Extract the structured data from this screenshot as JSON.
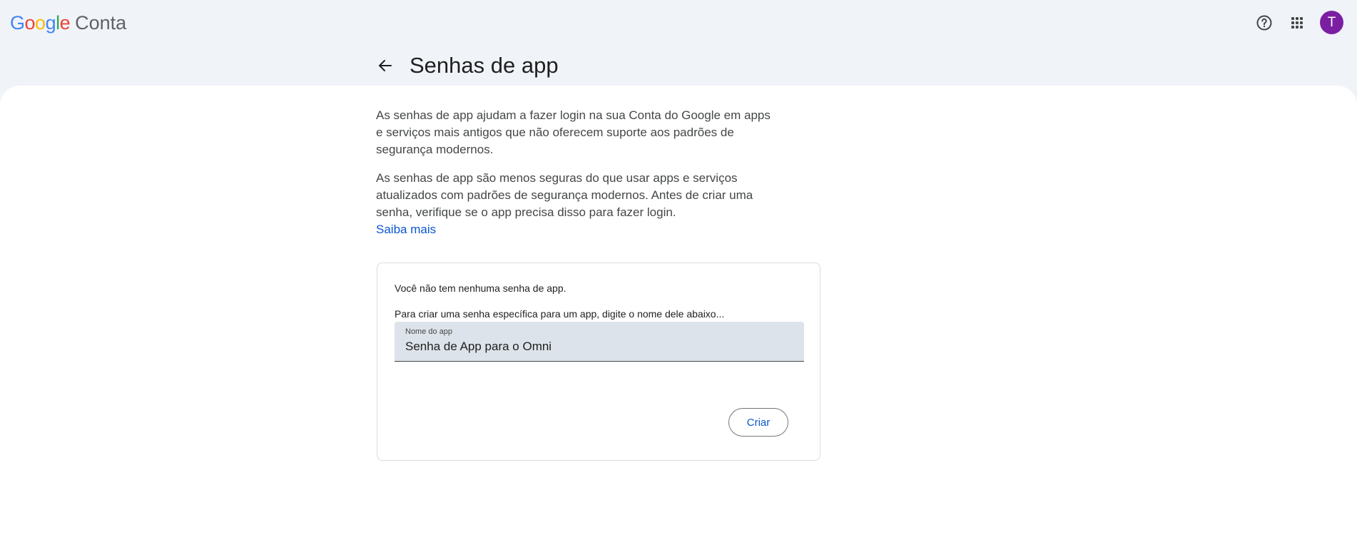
{
  "header": {
    "logo_google": "Google",
    "logo_product": "Conta",
    "avatar_initial": "T",
    "avatar_color": "#7b1fa2"
  },
  "page": {
    "title": "Senhas de app",
    "paragraph1": "As senhas de app ajudam a fazer login na sua Conta do Google em apps e serviços mais antigos que não oferecem suporte aos padrões de segurança modernos.",
    "paragraph2": "As senhas de app são menos seguras do que usar apps e serviços atualizados com padrões de segurança modernos. Antes de criar uma senha, verifique se o app precisa disso para fazer login.",
    "learn_more": "Saiba mais"
  },
  "card": {
    "empty_message": "Você não tem nenhuma senha de app.",
    "instructions": "Para criar uma senha específica para um app, digite o nome dele abaixo...",
    "field_label": "Nome do app",
    "field_value": "Senha de App para o Omni",
    "create_button": "Criar"
  },
  "icons": {
    "help": "help-circle-icon",
    "apps": "apps-grid-icon",
    "back": "arrow-back-icon"
  },
  "colors": {
    "background": "#f0f4f9",
    "link": "#0b57d0",
    "field_bg": "#dde3ea"
  }
}
